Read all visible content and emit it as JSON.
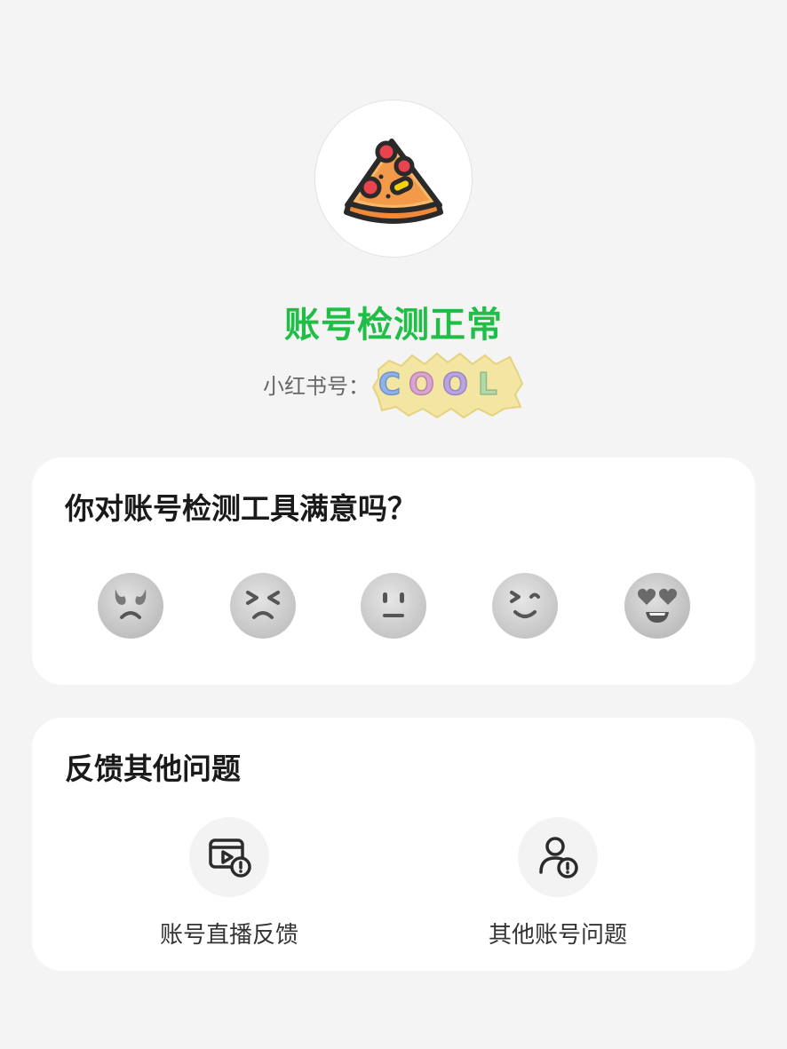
{
  "header": {
    "status_title": "账号检测正常",
    "account_label": "小红书号：",
    "avatar_icon": "pizza-slice-icon",
    "sticker_text": "COOL",
    "brand_color": "#1fbe46"
  },
  "survey": {
    "title": "你对账号检测工具满意吗？",
    "options": [
      {
        "icon": "angry-face-icon"
      },
      {
        "icon": "unhappy-face-icon"
      },
      {
        "icon": "neutral-face-icon"
      },
      {
        "icon": "smile-face-icon"
      },
      {
        "icon": "heart-eyes-face-icon"
      }
    ]
  },
  "feedback": {
    "title": "反馈其他问题",
    "items": [
      {
        "label": "账号直播反馈",
        "icon": "live-feedback-icon"
      },
      {
        "label": "其他账号问题",
        "icon": "user-issue-icon"
      }
    ]
  }
}
